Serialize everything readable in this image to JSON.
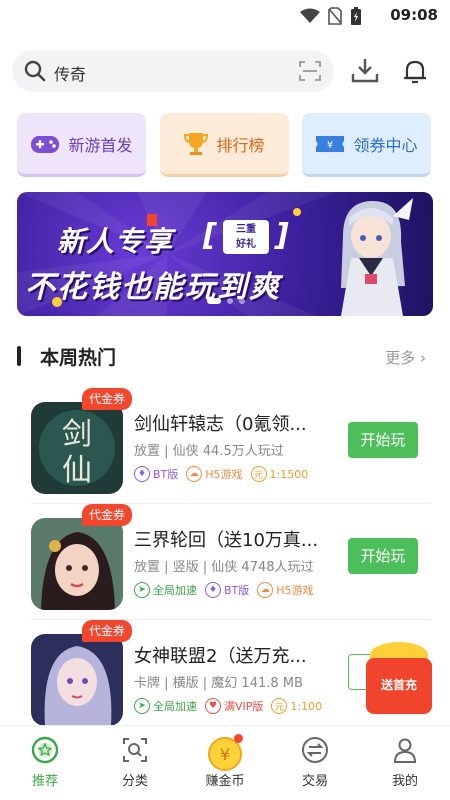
{
  "status_bar": {
    "time": "09:08"
  },
  "search": {
    "placeholder": "传奇"
  },
  "features": [
    {
      "label": "新游首发",
      "color": "#6b3dbf"
    },
    {
      "label": "排行榜",
      "color": "#e26718"
    },
    {
      "label": "领券中心",
      "color": "#2a6fcf"
    }
  ],
  "banner": {
    "line1": "新人专享",
    "tag_line1": "三重",
    "tag_line2": "好礼",
    "line2": "不花钱也能玩到爽"
  },
  "section": {
    "title": "本周热门",
    "more": "更多"
  },
  "games": [
    {
      "badge": "代金券",
      "name": "剑仙轩辕志（0氪领...",
      "meta": "放置 | 仙侠 44.5万人玩过",
      "tags": [
        {
          "icon": "BT",
          "label": "BT版",
          "color": "#8a5be0"
        },
        {
          "icon": "H5",
          "label": "H5游戏",
          "color": "#f08a3c"
        },
        {
          "icon": "元",
          "label": "1:1500",
          "color": "#e6a12a"
        }
      ],
      "action": "开始玩"
    },
    {
      "badge": "代金券",
      "name": "三界轮回（送10万真...",
      "meta": "放置 | 竖版 | 仙侠 4748人玩过",
      "tags": [
        {
          "icon": "速",
          "label": "全局加速",
          "color": "#3aa84a"
        },
        {
          "icon": "BT",
          "label": "BT版",
          "color": "#8a5be0"
        },
        {
          "icon": "H5",
          "label": "H5游戏",
          "color": "#f08a3c"
        }
      ],
      "action": "开始玩"
    },
    {
      "badge": "代金券",
      "name": "女神联盟2（送万充...",
      "meta": "卡牌 | 横版 | 魔幻 141.8 MB",
      "tags": [
        {
          "icon": "速",
          "label": "全局加速",
          "color": "#3aa84a"
        },
        {
          "icon": "V",
          "label": "满VIP版",
          "color": "#e0504a"
        },
        {
          "icon": "元",
          "label": "1:100",
          "color": "#e6a12a"
        }
      ],
      "action": ""
    }
  ],
  "promo": {
    "label": "送首充"
  },
  "nav": [
    {
      "label": "推荐"
    },
    {
      "label": "分类"
    },
    {
      "label": "赚金币"
    },
    {
      "label": "交易"
    },
    {
      "label": "我的"
    }
  ]
}
